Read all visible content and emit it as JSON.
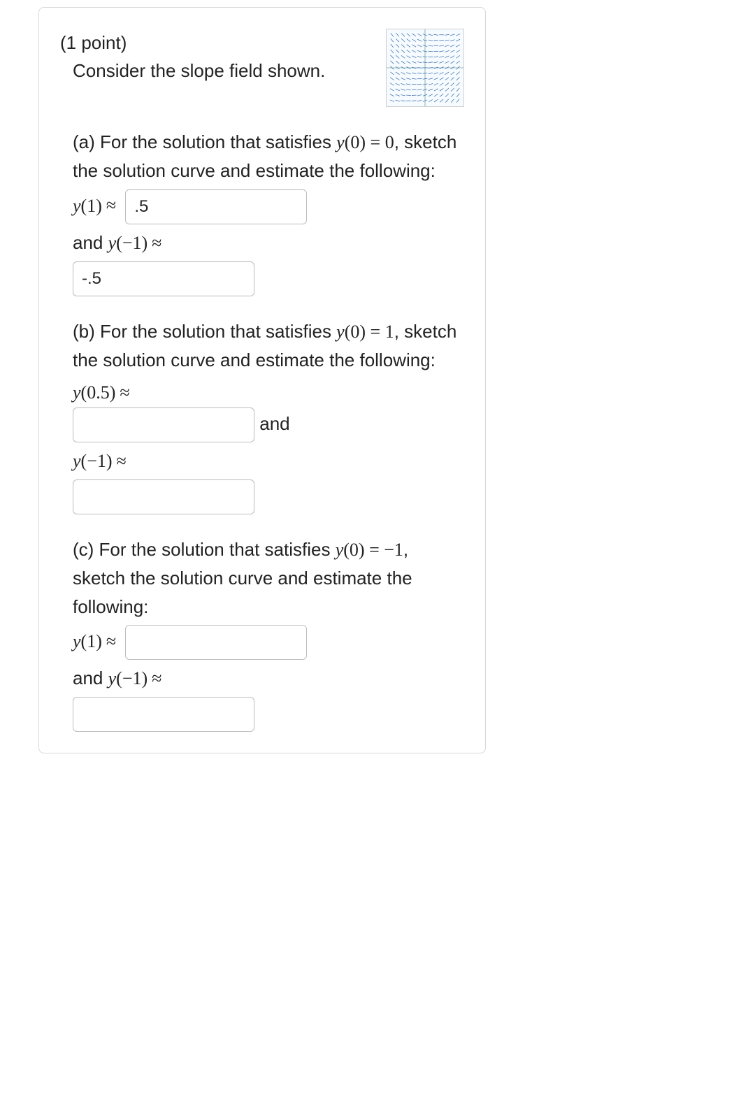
{
  "points_label": "(1 point)",
  "intro": "Consider the slope field shown.",
  "parts": {
    "a": {
      "prompt_pre": "(a) For the solution that satisfies ",
      "cond_math": "y(0) = 0",
      "prompt_post": ", sketch the solution curve and estimate the following:",
      "q1_math": "y(1) ≈",
      "q1_value": ".5",
      "and": "and ",
      "q2_math": "y(−1) ≈",
      "q2_value": "-.5"
    },
    "b": {
      "prompt_pre": "(b) For the solution that satisfies ",
      "cond_math": "y(0) = 1",
      "prompt_post": ", sketch the solution curve and estimate the following:",
      "q1_math": "y(0.5) ≈",
      "q1_value": "",
      "and": " and",
      "q2_math": "y(−1) ≈",
      "q2_value": ""
    },
    "c": {
      "prompt_pre": "(c) For the solution that satisfies ",
      "cond_math": "y(0) = −1",
      "prompt_post": ", sketch the solution curve and estimate the following:",
      "q1_math": "y(1) ≈",
      "q1_value": "",
      "and": "and ",
      "q2_math": "y(−1) ≈",
      "q2_value": ""
    }
  }
}
